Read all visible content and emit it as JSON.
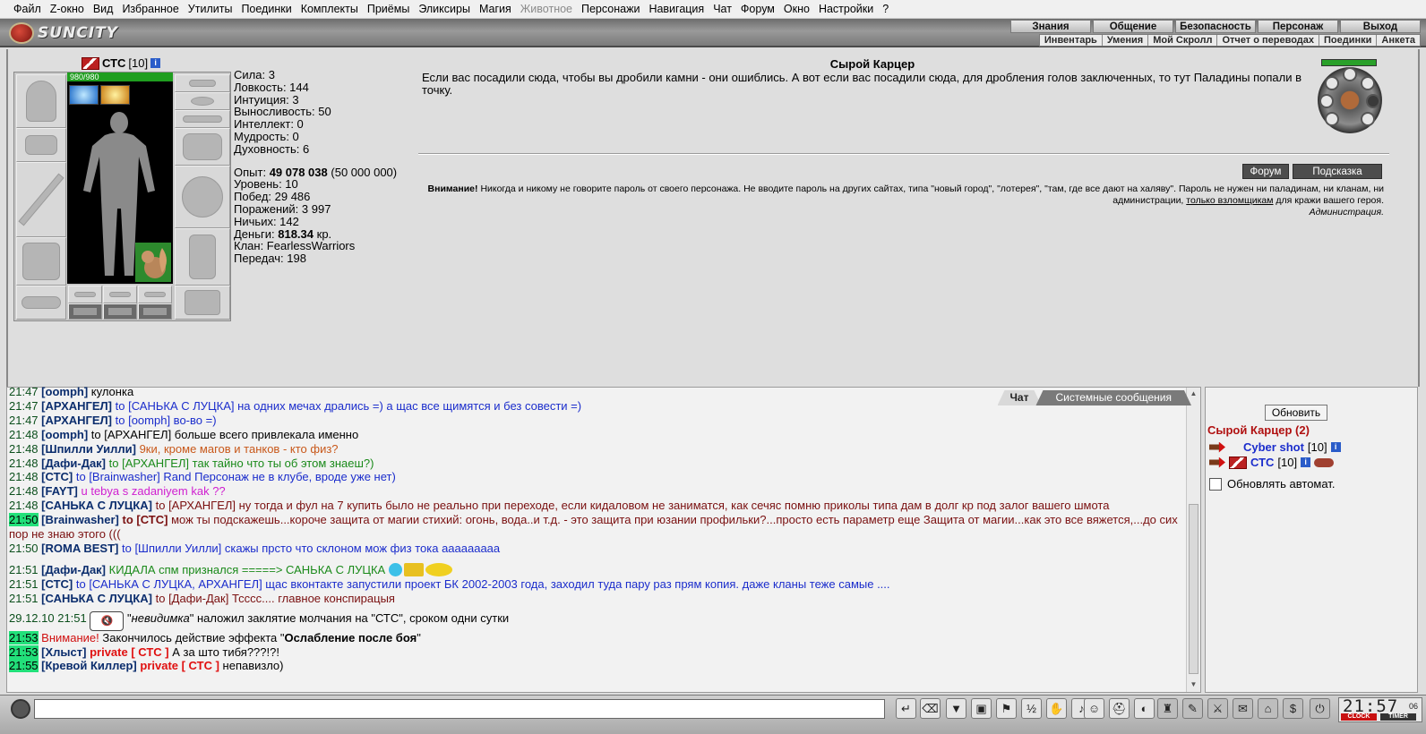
{
  "menu": [
    "Файл",
    "Z-окно",
    "Вид",
    "Избранное",
    "Утилиты",
    "Поединки",
    "Комплекты",
    "Приёмы",
    "Эликсиры",
    "Магия",
    "Животное",
    "Персонажи",
    "Навигация",
    "Чат",
    "Форум",
    "Окно",
    "Настройки",
    "?"
  ],
  "logo_text": "SUNCITY",
  "topnav": [
    "Знания",
    "Общение",
    "Безопасность",
    "Персонаж",
    "Выход"
  ],
  "subnav": [
    "Инвентарь",
    "Умения",
    "Мой Скролл",
    "Отчет о переводах",
    "Поединки",
    "Анкета"
  ],
  "character": {
    "name": "СТС",
    "level": "[10]",
    "hp": "980/980",
    "stats": [
      "Сила: 3",
      "Ловкость: 144",
      "Интуиция: 3",
      "Выносливость: 50",
      "Интеллект: 0",
      "Мудрость: 0",
      "Духовность: 6"
    ],
    "exp_label": "Опыт:",
    "exp_value": "49 078 038",
    "exp_next": "(50 000 000)",
    "level_line": "Уровень: 10",
    "wins": "Побед: 29 486",
    "losses": "Поражений: 3 997",
    "draws": "Ничьих: 142",
    "money_label": "Деньги:",
    "money_value": "818.34",
    "money_unit": "кр.",
    "clan": "Клан: FearlessWarriors",
    "transfers": "Передач: 198"
  },
  "location": {
    "title": "Сырой Карцер",
    "description": "Если вас посадили сюда, чтобы вы дробили камни - они ошиблись. А вот если вас посадили сюда, для дробления голов заключенных, то тут Паладины попали в точку.",
    "forum_button": "Форум",
    "hint_button": "Подсказка",
    "warning_title": "Внимание!",
    "warning_text1": "Никогда и никому не говорите пароль от своего персонажа. Не вводите пароль на других сайтах, типа \"новый город\", \"лотерея\", \"там, где все дают на халяву\". Пароль не нужен ни паладинам, ни кланам, ни администрации,",
    "warning_link": "только взломщикам",
    "warning_text2": "для кражи вашего героя.",
    "warning_sign": "Администрация."
  },
  "chat": {
    "tab_chat": "Чат",
    "tab_system": "Системные сообщения",
    "lines": {
      "l0": {
        "time": "21:47",
        "nick": "[oomph]",
        "text": "кулонка"
      },
      "l1": {
        "time": "21:47",
        "nick": "[АРХАНГЕЛ]",
        "text": "to [САНЬКА С ЛУЦКА] на одних мечах дрались =) а щас все щимятся и без совести =)"
      },
      "l2": {
        "time": "21:47",
        "nick": "[АРХАНГЕЛ]",
        "text": "to [oomph] во-во =)"
      },
      "l3": {
        "time": "21:48",
        "nick": "[oomph]",
        "text": "to [АРХАНГЕЛ] больше всего привлекала именно"
      },
      "l4": {
        "time": "21:48",
        "nick": "[Шпилли Уилли]",
        "text": "9ки, кроме магов и танков - кто физ?"
      },
      "l5": {
        "time": "21:48",
        "nick": "[Дафи-Дак]",
        "text": "to [АРХАНГЕЛ] так тайно что ты об этом знаеш?)"
      },
      "l6": {
        "time": "21:48",
        "nick": "[СТС]",
        "text": "to [Brainwasher] Rand Персонаж не в клубе, вроде уже нет)"
      },
      "l7": {
        "time": "21:48",
        "nick": "[FAYT]",
        "text": "u tebya s zadaniyem kak ??"
      },
      "l8": {
        "time": "21:48",
        "nick": "[САНЬКА С ЛУЦКА]",
        "text": "to [АРХАНГЕЛ] ну тогда и фул на 7 купить было не реально при переходе, если кидаловом не заниматся, как сечяс помню приколы типа дам в долг кр под залог вашего шмота"
      },
      "l9": {
        "time": "21:50",
        "nick": "[Brainwasher]",
        "to": "to [СТС]",
        "text": "мож ты подскажешь...короче защита от магии стихий: огонь, вода..и т.д. - это защита при юзании профильки?...просто есть параметр еще Защита от магии...как это все вяжется,...до сих пор не знаю этого ((("
      },
      "l10": {
        "time": "21:50",
        "nick": "[ROMA BEST]",
        "text": "to [Шпилли Уилли] скажы прсто что склоном мож физ тока ааааааааа"
      },
      "l11": {
        "time": "21:51",
        "nick": "[Дафи-Дак]",
        "text": "КИДАЛА спм признался =====> САНЬКА С ЛУЦКА"
      },
      "l12": {
        "time": "21:51",
        "nick": "[СТС]",
        "text": "to [САНЬКА С ЛУЦКА, АРХАНГЕЛ] щас вконтакте запустили проект БК 2002-2003 года, заходил туда пару раз прям копия. даже кланы теже самые ...."
      },
      "l13": {
        "time": "21:51",
        "nick": "[САНЬКА С ЛУЦКА]",
        "text": "to [Дафи-Дак] Тсссс.... главное конспирацыя"
      },
      "l14": {
        "time": "29.12.10 21:51",
        "who": "невидимка",
        "text1": "\"",
        "text2": "\" наложил заклятие молчания на \"СТС\", сроком одни сутки"
      },
      "l15": {
        "time": "21:53",
        "alert": "Внимание!",
        "text": "Закончилось действие эффекта \"",
        "effect": "Ослабление после боя",
        "end": "\""
      },
      "l16": {
        "time": "21:53",
        "nick": "[Хлыст]",
        "private": "private [ СТС ]",
        "text": "А за што тибя???!?!"
      },
      "l17": {
        "time": "21:55",
        "nick": "[Кревой Киллер]",
        "private": "private [ СТС ]",
        "text": "непавизло)"
      }
    }
  },
  "online": {
    "refresh_button": "Обновить",
    "room": "Сырой Карцер (2)",
    "players": [
      {
        "name": "Cyber shot",
        "level": "[10]"
      },
      {
        "name": "СТС",
        "level": "[10]"
      }
    ],
    "auto_update": "Обновлять автомат."
  },
  "clock": {
    "time": "21:57",
    "seconds": "06",
    "label_clock": "CLOCK",
    "label_timer": "TIMER"
  },
  "colors": {
    "hp": "#1f9e1f",
    "highlight_time": "#22e07a",
    "room_title": "#b01010",
    "player_name": "#1b2dcc"
  }
}
